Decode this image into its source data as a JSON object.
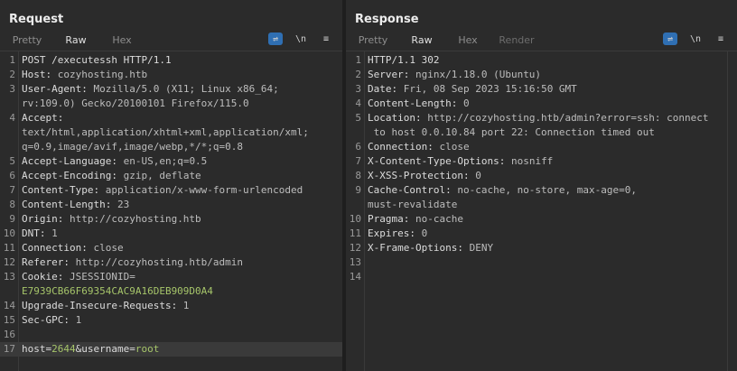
{
  "request": {
    "title": "Request",
    "tabs": [
      "Pretty",
      "Raw",
      "Hex"
    ],
    "active_tab": "Raw",
    "tools": {
      "wrap": "wrap-icon",
      "newline": "\\n",
      "menu": "≡"
    },
    "lines": [
      {
        "n": "1",
        "k": "POST /executessh HTTP/1.1",
        "v": ""
      },
      {
        "n": "2",
        "k": "Host:",
        "v": " cozyhosting.htb"
      },
      {
        "n": "3",
        "k": "User-Agent:",
        "v": " Mozilla/5.0 (X11; Linux x86_64;"
      },
      {
        "n": "",
        "k": "",
        "v": "rv:109.0) Gecko/20100101 Firefox/115.0"
      },
      {
        "n": "4",
        "k": "Accept:",
        "v": ""
      },
      {
        "n": "",
        "k": "",
        "v": "text/html,application/xhtml+xml,application/xml;"
      },
      {
        "n": "",
        "k": "",
        "v": "q=0.9,image/avif,image/webp,*/*;q=0.8"
      },
      {
        "n": "5",
        "k": "Accept-Language:",
        "v": " en-US,en;q=0.5"
      },
      {
        "n": "6",
        "k": "Accept-Encoding:",
        "v": " gzip, deflate"
      },
      {
        "n": "7",
        "k": "Content-Type:",
        "v": " application/x-www-form-urlencoded"
      },
      {
        "n": "8",
        "k": "Content-Length:",
        "v": " 23"
      },
      {
        "n": "9",
        "k": "Origin:",
        "v": " http://cozyhosting.htb"
      },
      {
        "n": "10",
        "k": "DNT:",
        "v": " 1"
      },
      {
        "n": "11",
        "k": "Connection:",
        "v": " close"
      },
      {
        "n": "12",
        "k": "Referer:",
        "v": " http://cozyhosting.htb/admin"
      },
      {
        "n": "13",
        "k": "Cookie:",
        "v": " JSESSIONID="
      },
      {
        "n": "",
        "k": "",
        "v": "E7939CB66F69354CAC9A16DEB909D0A4",
        "green": true
      },
      {
        "n": "14",
        "k": "Upgrade-Insecure-Requests:",
        "v": " 1"
      },
      {
        "n": "15",
        "k": "Sec-GPC:",
        "v": " 1"
      },
      {
        "n": "16",
        "k": "",
        "v": ""
      },
      {
        "n": "17",
        "k": "",
        "v": "",
        "body": [
          "host=",
          "2644",
          "&username=",
          "root"
        ]
      }
    ]
  },
  "response": {
    "title": "Response",
    "tabs": [
      "Pretty",
      "Raw",
      "Hex",
      "Render"
    ],
    "active_tab": "Raw",
    "lines": [
      {
        "n": "1",
        "k": "HTTP/1.1 302",
        "v": ""
      },
      {
        "n": "2",
        "k": "Server:",
        "v": " nginx/1.18.0 (Ubuntu)"
      },
      {
        "n": "3",
        "k": "Date:",
        "v": " Fri, 08 Sep 2023 15:16:50 GMT"
      },
      {
        "n": "4",
        "k": "Content-Length:",
        "v": " 0"
      },
      {
        "n": "5",
        "k": "Location:",
        "v": " http://cozyhosting.htb/admin?error=ssh: connect"
      },
      {
        "n": "",
        "k": "",
        "v": " to host 0.0.10.84 port 22: Connection timed out"
      },
      {
        "n": "6",
        "k": "Connection:",
        "v": " close"
      },
      {
        "n": "7",
        "k": "X-Content-Type-Options:",
        "v": " nosniff"
      },
      {
        "n": "8",
        "k": "X-XSS-Protection:",
        "v": " 0"
      },
      {
        "n": "9",
        "k": "Cache-Control:",
        "v": " no-cache, no-store, max-age=0,"
      },
      {
        "n": "",
        "k": "",
        "v": "must-revalidate"
      },
      {
        "n": "10",
        "k": "Pragma:",
        "v": " no-cache"
      },
      {
        "n": "11",
        "k": "Expires:",
        "v": " 0"
      },
      {
        "n": "12",
        "k": "X-Frame-Options:",
        "v": " DENY"
      },
      {
        "n": "13",
        "k": "",
        "v": ""
      },
      {
        "n": "14",
        "k": "",
        "v": ""
      }
    ]
  },
  "layout_buttons": [
    "side-by-side",
    "stacked",
    "single"
  ],
  "colors": {
    "accent": "#2f6fb3",
    "tab_underline": "#e06a3c",
    "value_green": "#a6c56a"
  }
}
